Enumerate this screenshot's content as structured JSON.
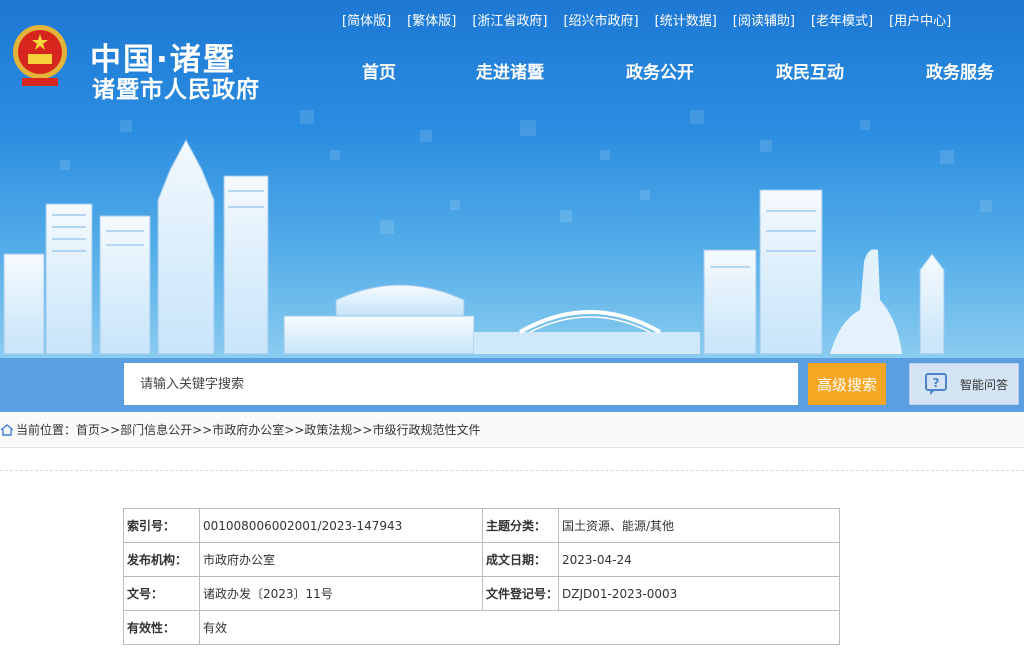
{
  "site": {
    "title": "中国·诸暨",
    "subtitle": "诸暨市人民政府"
  },
  "top_links": [
    "[简体版]",
    "[繁体版]",
    "[浙江省政府]",
    "[绍兴市政府]",
    "[统计数据]",
    "[阅读辅助]",
    "[老年模式]",
    "[用户中心]"
  ],
  "main_nav": [
    "首页",
    "走进诸暨",
    "政务公开",
    "政民互动",
    "政务服务"
  ],
  "search": {
    "placeholder": "请输入关键字搜索",
    "advanced_label": "高级搜索",
    "qa_label": "智能问答",
    "qa_icon": "chat-question-icon"
  },
  "breadcrumb": {
    "prefix": "当前位置：",
    "items": [
      "首页",
      "部门信息公开",
      "市政府办公室",
      "政策法规",
      "市级行政规范性文件"
    ],
    "separator": ">>"
  },
  "info": {
    "index_label": "索引号：",
    "index_value": "001008006002001/2023-147943",
    "topic_label": "主题分类：",
    "topic_value": "国土资源、能源/其他",
    "publisher_label": "发布机构：",
    "publisher_value": "市政府办公室",
    "date_label": "成文日期：",
    "date_value": "2023-04-24",
    "docno_label": "文号：",
    "docno_value": "诸政办发〔2023〕11号",
    "reg_label": "文件登记号：",
    "reg_value": "DZJD01-2023-0003",
    "validity_label": "有效性：",
    "validity_value": "有效"
  },
  "colors": {
    "banner_top": "#1d78d4",
    "search_band": "#5b9fe0",
    "advanced_button": "#f5a623"
  }
}
